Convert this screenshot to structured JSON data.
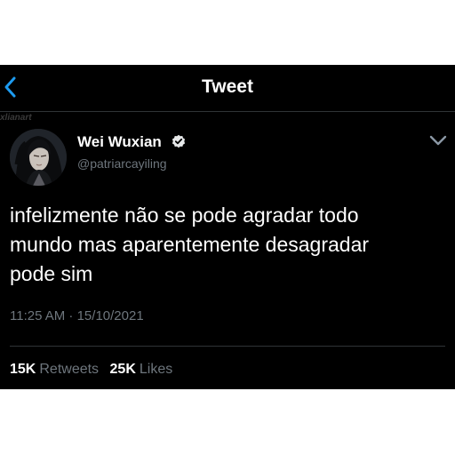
{
  "header": {
    "title": "Tweet",
    "back_icon": "chevron-left-icon",
    "accent_color": "#1d9bf0"
  },
  "watermark": "xlianart",
  "author": {
    "display_name": "Wei Wuxian",
    "handle": "@patriarcayiling",
    "verified": true,
    "verified_icon": "verified-badge-icon",
    "avatar": "avatar-image"
  },
  "menu": {
    "icon": "chevron-down-icon"
  },
  "tweet": {
    "text": "infelizmente não se pode agradar todo\nmundo mas aparentemente desagradar\npode sim",
    "timestamp": "11:25 AM · 15/10/2021"
  },
  "stats": {
    "retweets_count": "15K",
    "retweets_label": "Retweets",
    "likes_count": "25K",
    "likes_label": "Likes"
  },
  "colors": {
    "background": "#000000",
    "text": "#ffffff",
    "secondary_text": "#6e767d",
    "divider": "#2f3336"
  }
}
